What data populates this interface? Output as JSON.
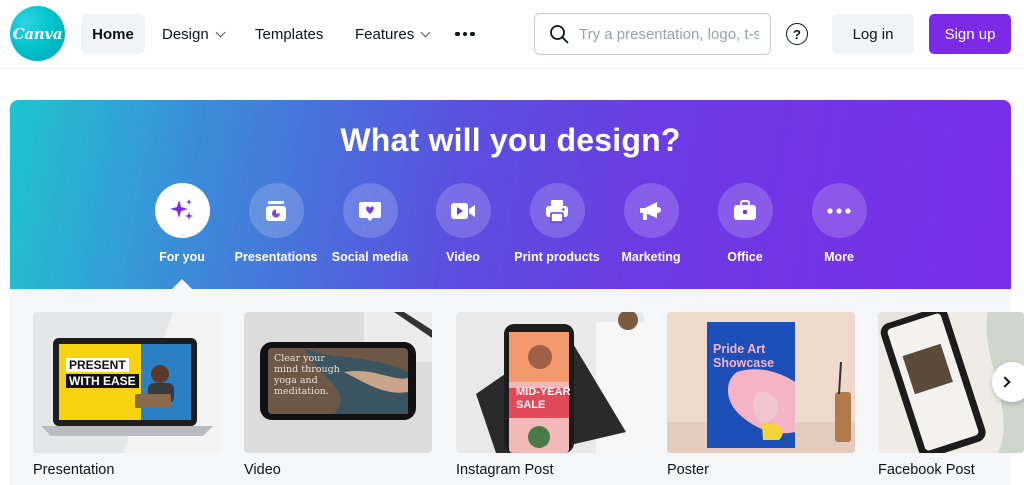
{
  "header": {
    "logo_text": "Canva",
    "nav": [
      {
        "label": "Home"
      },
      {
        "label": "Design"
      },
      {
        "label": "Templates"
      },
      {
        "label": "Features"
      }
    ],
    "search_placeholder": "Try a presentation, logo, t-s",
    "help_label": "?",
    "login_label": "Log in",
    "signup_label": "Sign up"
  },
  "hero": {
    "title": "What will you design?",
    "categories": [
      {
        "label": "For you",
        "icon": "sparkle-icon"
      },
      {
        "label": "Presentations",
        "icon": "presentation-icon"
      },
      {
        "label": "Social media",
        "icon": "heart-chat-icon"
      },
      {
        "label": "Video",
        "icon": "video-camera-icon"
      },
      {
        "label": "Print products",
        "icon": "printer-icon"
      },
      {
        "label": "Marketing",
        "icon": "megaphone-icon"
      },
      {
        "label": "Office",
        "icon": "briefcase-icon"
      },
      {
        "label": "More",
        "icon": "more-dots-icon"
      }
    ]
  },
  "cards": [
    {
      "label": "Presentation",
      "thumb_text": [
        "PRESENT",
        "WITH EASE"
      ]
    },
    {
      "label": "Video",
      "thumb_text": [
        "Clear your",
        "mind through",
        "yoga and",
        "meditation."
      ]
    },
    {
      "label": "Instagram Post",
      "thumb_text": [
        "MID-YEAR",
        "SALE"
      ]
    },
    {
      "label": "Poster",
      "thumb_text": [
        "Pride Art",
        "Showcase"
      ]
    },
    {
      "label": "Facebook Post",
      "thumb_text": []
    }
  ],
  "colors": {
    "brand_purple": "#7d2ae8",
    "logo_teal": "#00c4cc",
    "hero_gradient_start": "#1ec4cf",
    "hero_gradient_end": "#7a2ee6"
  }
}
